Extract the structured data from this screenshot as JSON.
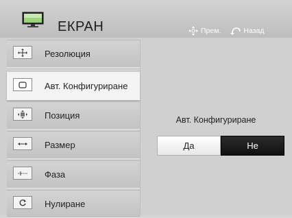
{
  "header": {
    "title": "ЕКРАН",
    "move_hint": "Прем.",
    "back_hint": "Назад"
  },
  "sidebar": {
    "items": [
      {
        "label": "Резолюция",
        "icon": "resolution-icon"
      },
      {
        "label": "Авт. Конфигуриране",
        "icon": "auto-config-icon",
        "active": true
      },
      {
        "label": "Позиция",
        "icon": "position-icon"
      },
      {
        "label": "Размер",
        "icon": "size-icon"
      },
      {
        "label": "Фаза",
        "icon": "phase-icon"
      },
      {
        "label": "Нулиране",
        "icon": "reset-icon"
      }
    ]
  },
  "panel": {
    "label": "Авт. Конфигуриране",
    "yes_label": "Да",
    "no_label": "Не",
    "selected": "Не"
  },
  "colors": {
    "selected_button": "#111111",
    "unselected_button": "#ffffff",
    "active_item": "#f4f4f4"
  }
}
